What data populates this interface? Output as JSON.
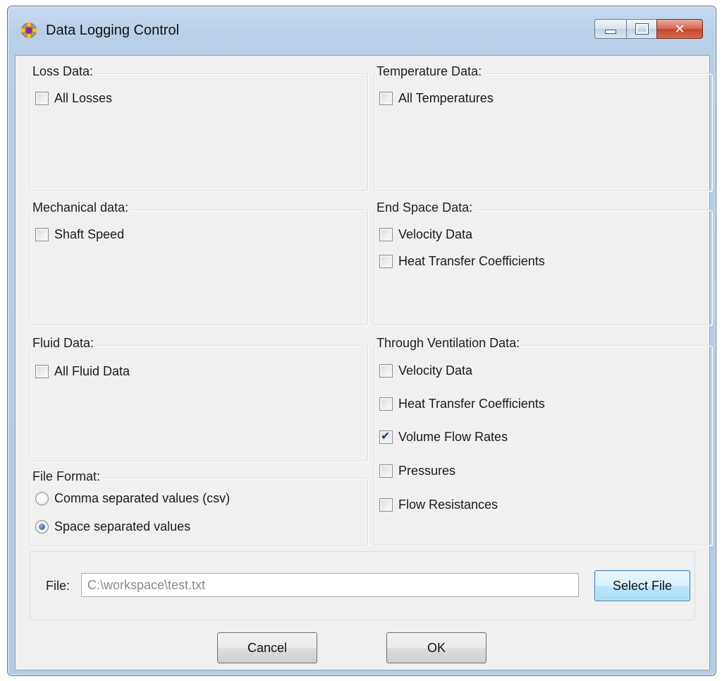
{
  "window": {
    "title": "Data Logging Control",
    "icon": "gear-flower-icon"
  },
  "groups": {
    "loss": {
      "label": "Loss Data:",
      "items": [
        {
          "label": "All Losses",
          "checked": false
        }
      ]
    },
    "temperature": {
      "label": "Temperature Data:",
      "items": [
        {
          "label": "All Temperatures",
          "checked": false
        }
      ]
    },
    "mechanical": {
      "label": "Mechanical data:",
      "items": [
        {
          "label": "Shaft Speed",
          "checked": false
        }
      ]
    },
    "end_space": {
      "label": "End Space Data:",
      "items": [
        {
          "label": "Velocity Data",
          "checked": false
        },
        {
          "label": "Heat Transfer Coefficients",
          "checked": false
        }
      ]
    },
    "fluid": {
      "label": "Fluid Data:",
      "items": [
        {
          "label": "All Fluid Data",
          "checked": false
        }
      ]
    },
    "through_ventilation": {
      "label": "Through Ventilation Data:",
      "items": [
        {
          "label": "Velocity Data",
          "checked": false
        },
        {
          "label": "Heat Transfer Coefficients",
          "checked": false
        },
        {
          "label": "Volume Flow Rates",
          "checked": true
        },
        {
          "label": "Pressures",
          "checked": false
        },
        {
          "label": "Flow Resistances",
          "checked": false
        }
      ]
    },
    "file_format": {
      "label": "File Format:",
      "options": [
        {
          "label": "Comma separated values (csv)",
          "selected": false
        },
        {
          "label": "Space separated values",
          "selected": true
        }
      ]
    }
  },
  "file": {
    "label": "File:",
    "value": "C:\\workspace\\test.txt",
    "select_button": "Select File"
  },
  "buttons": {
    "cancel": "Cancel",
    "ok": "OK"
  }
}
